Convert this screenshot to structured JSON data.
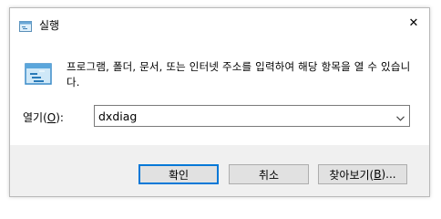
{
  "window": {
    "title": "실행",
    "close_glyph": "✕"
  },
  "description": "프로그램, 폴더, 문서, 또는 인터넷 주소를 입력하여 해당 항목을 열 수 있습니다.",
  "open_field": {
    "label_prefix": "열기(",
    "label_mnemonic": "O",
    "label_suffix": "):",
    "value": "dxdiag"
  },
  "buttons": {
    "ok": "확인",
    "cancel": "취소",
    "browse_prefix": "찾아보기(",
    "browse_mnemonic": "B",
    "browse_suffix": ")..."
  },
  "icons": {
    "title": "run-icon",
    "main": "run-icon",
    "close": "close-icon",
    "dropdown": "chevron-down-icon"
  },
  "colors": {
    "accent": "#0078d7",
    "footer_bg": "#f0f0f0",
    "button_bg": "#e1e1e1"
  }
}
